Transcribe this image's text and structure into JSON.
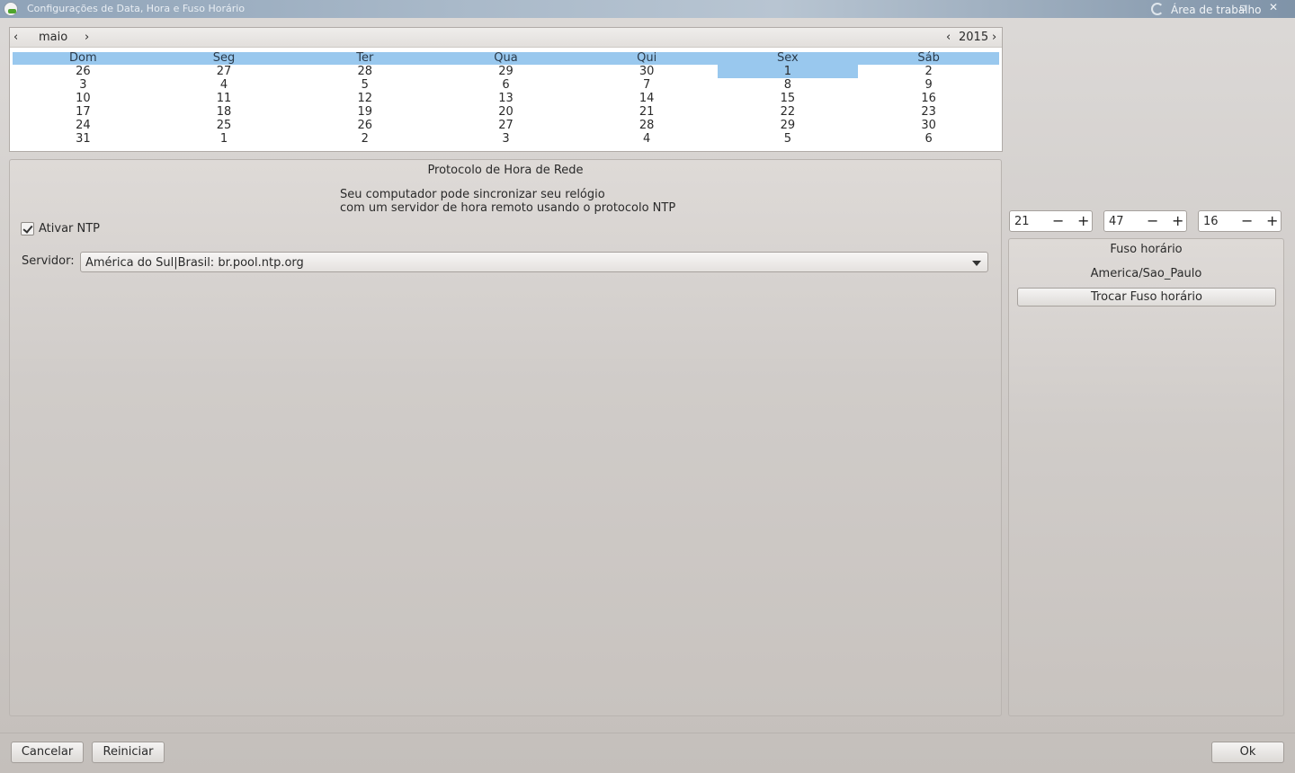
{
  "window": {
    "title": "Configurações de Data, Hora e Fuso Horário",
    "workspace_label": "Área de trabalho",
    "restore_glyph": "▫",
    "close_glyph": "✕"
  },
  "calendar": {
    "month": "maio",
    "year": "2015",
    "prev_month": "‹",
    "next_month": "›",
    "prev_year": "‹",
    "next_year": "›",
    "weekdays": [
      "Dom",
      "Seg",
      "Ter",
      "Qua",
      "Qui",
      "Sex",
      "Sáb"
    ],
    "selected_day": "1",
    "weeks": [
      [
        "26",
        "27",
        "28",
        "29",
        "30",
        "1",
        "2"
      ],
      [
        "3",
        "4",
        "5",
        "6",
        "7",
        "8",
        "9"
      ],
      [
        "10",
        "11",
        "12",
        "13",
        "14",
        "15",
        "16"
      ],
      [
        "17",
        "18",
        "19",
        "20",
        "21",
        "22",
        "23"
      ],
      [
        "24",
        "25",
        "26",
        "27",
        "28",
        "29",
        "30"
      ],
      [
        "31",
        "1",
        "2",
        "3",
        "4",
        "5",
        "6"
      ]
    ]
  },
  "ntp": {
    "title": "Protocolo de Hora de Rede",
    "description_line1": "Seu computador pode sincronizar seu relógio",
    "description_line2": "com um servidor de hora remoto usando o protocolo NTP",
    "enable_label": "Ativar NTP",
    "enabled": true,
    "server_label": "Servidor:",
    "server_value": "América do Sul|Brasil: br.pool.ntp.org"
  },
  "time": {
    "hours": "21",
    "minutes": "47",
    "seconds": "16",
    "minus_glyph": "−",
    "plus_glyph": "+"
  },
  "timezone": {
    "title": "Fuso horário",
    "value": "America/Sao_Paulo",
    "change_button": "Trocar Fuso horário"
  },
  "footer": {
    "cancel": "Cancelar",
    "reset": "Reiniciar",
    "ok": "Ok"
  },
  "colors": {
    "selection": "#99c8ee"
  }
}
